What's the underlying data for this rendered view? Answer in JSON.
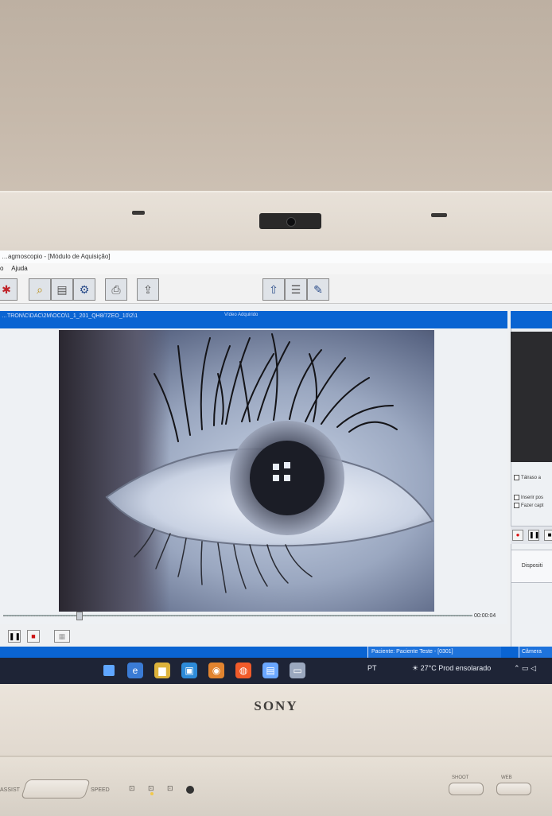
{
  "window": {
    "title": "…agmoscopio - [Módulo de Aquisição]",
    "menu": [
      "o",
      "Ajuda"
    ]
  },
  "capture": {
    "file_path": "…TRON\\C\\DAC\\2M\\OCO\\1_1_201_QH8/7ZEO_10\\2\\1",
    "header_label": "Vídeo Adquirido",
    "timecode": "00:00:04"
  },
  "side_panel": {
    "checkbox_1": "Tálraso a",
    "checkbox_2": "Inserir pos",
    "checkbox_3": "Fazer capt",
    "device_label": "Dispositi"
  },
  "status": {
    "patient": "Paciente: Paciente Teste - [0301]",
    "camera": "Câmera"
  },
  "taskbar": {
    "lang": "PT",
    "weather": "27°C Prod ensolarado"
  },
  "hardware": {
    "brand": "SONY",
    "assist_label": "ASSIST",
    "speed_label": "SPEED",
    "button_1_label": "SHOOT",
    "button_2_label": "WEB"
  }
}
